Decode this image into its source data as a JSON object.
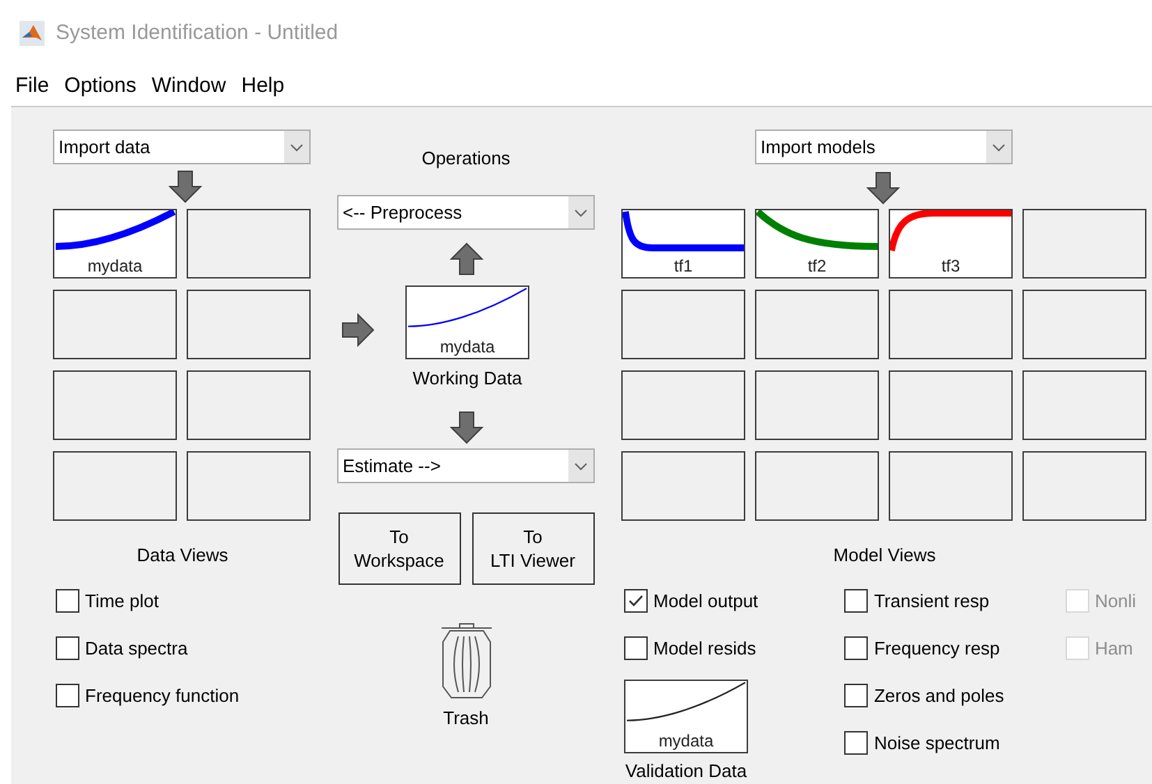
{
  "window": {
    "title": "System Identification - Untitled"
  },
  "menu": [
    "File",
    "Options",
    "Window",
    "Help"
  ],
  "data_board": {
    "dropdown": "Import data",
    "tiles": [
      {
        "kind": "rising",
        "label": "mydata",
        "color": "#0000ff"
      },
      {
        "kind": "empty"
      },
      {
        "kind": "empty"
      },
      {
        "kind": "empty"
      },
      {
        "kind": "empty"
      },
      {
        "kind": "empty"
      },
      {
        "kind": "empty"
      },
      {
        "kind": "empty"
      }
    ]
  },
  "operations": {
    "title": "Operations",
    "preprocess": "<-- Preprocess",
    "working_data": {
      "kind": "rising",
      "label": "mydata",
      "caption": "Working Data"
    },
    "estimate": "Estimate -->",
    "buttons": [
      [
        "To",
        "Workspace"
      ],
      [
        "To",
        "LTI Viewer"
      ]
    ],
    "trash": "Trash"
  },
  "model_board": {
    "dropdown": "Import models",
    "tiles": [
      {
        "kind": "falling_fast",
        "label": "tf1",
        "color": "#0000ff"
      },
      {
        "kind": "falling",
        "label": "tf2",
        "color": "#008000"
      },
      {
        "kind": "rising_fast",
        "label": "tf3",
        "color": "#ff0000"
      },
      {
        "kind": "empty"
      },
      {
        "kind": "empty"
      },
      {
        "kind": "empty"
      },
      {
        "kind": "empty"
      },
      {
        "kind": "empty"
      },
      {
        "kind": "empty"
      },
      {
        "kind": "empty"
      },
      {
        "kind": "empty"
      },
      {
        "kind": "empty"
      },
      {
        "kind": "empty"
      },
      {
        "kind": "empty"
      },
      {
        "kind": "empty"
      },
      {
        "kind": "empty"
      }
    ]
  },
  "data_views": {
    "title": "Data Views",
    "options": [
      {
        "label": "Time plot",
        "checked": false
      },
      {
        "label": "Data spectra",
        "checked": false
      },
      {
        "label": "Frequency function",
        "checked": false
      }
    ]
  },
  "model_views": {
    "title": "Model Views",
    "columns": [
      {
        "options": [
          {
            "label": "Model output",
            "checked": true,
            "disabled": false
          },
          {
            "label": "Model resids",
            "checked": false,
            "disabled": false
          }
        ]
      },
      {
        "options": [
          {
            "label": "Transient resp",
            "checked": false,
            "disabled": false
          },
          {
            "label": "Frequency resp",
            "checked": false,
            "disabled": false
          },
          {
            "label": "Zeros and poles",
            "checked": false,
            "disabled": false
          },
          {
            "label": "Noise spectrum",
            "checked": false,
            "disabled": false
          }
        ]
      },
      {
        "options": [
          {
            "label": "Nonli",
            "checked": false,
            "disabled": true
          },
          {
            "label": "Ham",
            "checked": false,
            "disabled": true
          }
        ]
      }
    ],
    "validation_data": {
      "kind": "rising",
      "label": "mydata",
      "caption": "Validation Data"
    }
  }
}
